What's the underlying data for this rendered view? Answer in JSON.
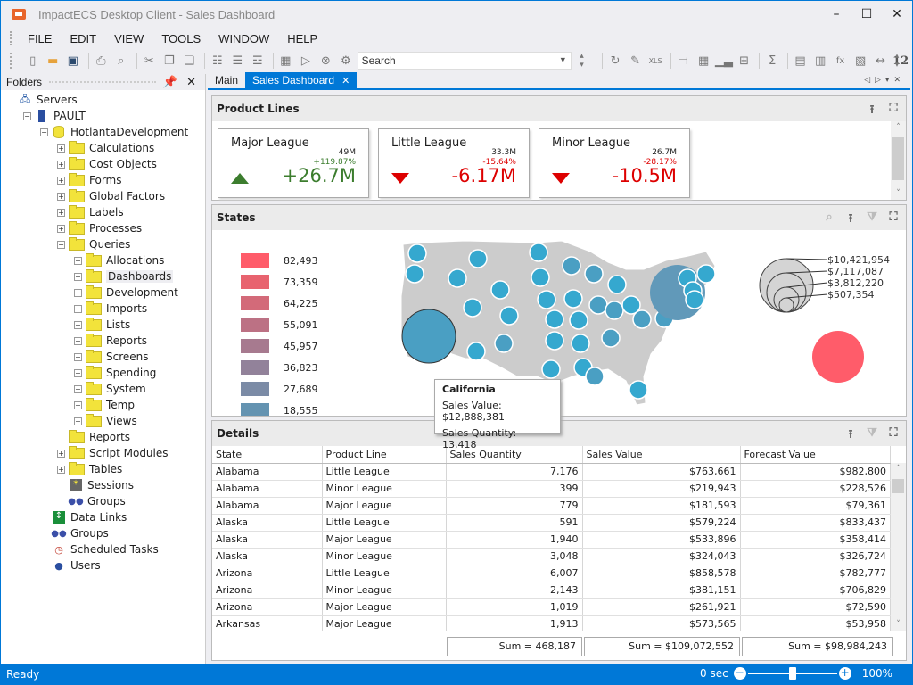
{
  "window": {
    "title": "ImpactECS Desktop Client - Sales Dashboard"
  },
  "menu": [
    "FILE",
    "EDIT",
    "VIEW",
    "TOOLS",
    "WINDOW",
    "HELP"
  ],
  "toolbar": {
    "search_placeholder": "Search",
    "search_value": "Search",
    "number_label": "12"
  },
  "sidebar": {
    "title": "Folders",
    "tree": [
      {
        "label": "Servers",
        "level": 0,
        "icon": "servers-icon"
      },
      {
        "label": "PAULT",
        "level": 1,
        "icon": "server-icon",
        "expander": "minus"
      },
      {
        "label": "HotlantaDevelopment",
        "level": 2,
        "icon": "database-icon",
        "expander": "minus"
      },
      {
        "label": "Calculations",
        "level": 3,
        "icon": "folder-icon",
        "expander": "plus"
      },
      {
        "label": "Cost Objects",
        "level": 3,
        "icon": "folder-icon",
        "expander": "plus"
      },
      {
        "label": "Forms",
        "level": 3,
        "icon": "folder-icon",
        "expander": "plus"
      },
      {
        "label": "Global Factors",
        "level": 3,
        "icon": "folder-icon",
        "expander": "plus"
      },
      {
        "label": "Labels",
        "level": 3,
        "icon": "folder-icon",
        "expander": "plus"
      },
      {
        "label": "Processes",
        "level": 3,
        "icon": "folder-icon",
        "expander": "plus"
      },
      {
        "label": "Queries",
        "level": 3,
        "icon": "folder-icon",
        "expander": "minus"
      },
      {
        "label": "Allocations",
        "level": 4,
        "icon": "folder-icon",
        "expander": "plus"
      },
      {
        "label": "Dashboards",
        "level": 4,
        "icon": "folder-icon",
        "expander": "plus",
        "selected": true
      },
      {
        "label": "Development",
        "level": 4,
        "icon": "folder-icon",
        "expander": "plus"
      },
      {
        "label": "Imports",
        "level": 4,
        "icon": "folder-icon",
        "expander": "plus"
      },
      {
        "label": "Lists",
        "level": 4,
        "icon": "folder-icon",
        "expander": "plus"
      },
      {
        "label": "Reports",
        "level": 4,
        "icon": "folder-icon",
        "expander": "plus"
      },
      {
        "label": "Screens",
        "level": 4,
        "icon": "folder-icon",
        "expander": "plus"
      },
      {
        "label": "Spending",
        "level": 4,
        "icon": "folder-icon",
        "expander": "plus"
      },
      {
        "label": "System",
        "level": 4,
        "icon": "folder-icon",
        "expander": "plus"
      },
      {
        "label": "Temp",
        "level": 4,
        "icon": "folder-icon",
        "expander": "plus"
      },
      {
        "label": "Views",
        "level": 4,
        "icon": "folder-icon",
        "expander": "plus"
      },
      {
        "label": "Reports",
        "level": 3,
        "icon": "folder-icon"
      },
      {
        "label": "Script Modules",
        "level": 3,
        "icon": "folder-icon",
        "expander": "plus"
      },
      {
        "label": "Tables",
        "level": 3,
        "icon": "folder-icon",
        "expander": "plus"
      },
      {
        "label": "Sessions",
        "level": 3,
        "icon": "sessions-icon"
      },
      {
        "label": "Groups",
        "level": 3,
        "icon": "groups-icon"
      },
      {
        "label": "Data Links",
        "level": 2,
        "icon": "data-links-icon"
      },
      {
        "label": "Groups",
        "level": 2,
        "icon": "groups-icon"
      },
      {
        "label": "Scheduled Tasks",
        "level": 2,
        "icon": "scheduled-tasks-icon"
      },
      {
        "label": "Users",
        "level": 2,
        "icon": "users-icon"
      }
    ]
  },
  "tabs": [
    {
      "label": "Main"
    },
    {
      "label": "Sales Dashboard",
      "active": true
    }
  ],
  "product_lines": {
    "title": "Product Lines",
    "cards": [
      {
        "title": "Major League",
        "reference": "49M",
        "percent": "+119.87%",
        "delta": "+26.7M",
        "trend": "up"
      },
      {
        "title": "Little League",
        "reference": "33.3M",
        "percent": "-15.64%",
        "delta": "-6.17M",
        "trend": "down"
      },
      {
        "title": "Minor League",
        "reference": "26.7M",
        "percent": "-28.17%",
        "delta": "-10.5M",
        "trend": "down"
      }
    ]
  },
  "states": {
    "title": "States",
    "color_legend": [
      {
        "value": "82,493",
        "color": "#ff5c6a"
      },
      {
        "value": "73,359",
        "color": "#e8636f"
      },
      {
        "value": "64,225",
        "color": "#d36a79"
      },
      {
        "value": "55,091",
        "color": "#bc7184"
      },
      {
        "value": "45,957",
        "color": "#a77a8f"
      },
      {
        "value": "36,823",
        "color": "#92829a"
      },
      {
        "value": "27,689",
        "color": "#7b8ba6"
      },
      {
        "value": "18,555",
        "color": "#6493b1"
      }
    ],
    "size_legend": [
      "$10,421,954",
      "$7,117,087",
      "$3,812,220",
      "$507,354"
    ],
    "tooltip": {
      "title": "California",
      "sales_value": "Sales Value: $12,888,381",
      "sales_quantity": "Sales Quantity: 13,418"
    }
  },
  "details": {
    "title": "Details",
    "columns": [
      "State",
      "Product Line",
      "Sales Quantity",
      "Sales Value",
      "Forecast Value"
    ],
    "rows": [
      [
        "Alabama",
        "Little League",
        "7,176",
        "$763,661",
        "$982,800"
      ],
      [
        "Alabama",
        "Minor League",
        "399",
        "$219,943",
        "$228,526"
      ],
      [
        "Alabama",
        "Major League",
        "779",
        "$181,593",
        "$79,361"
      ],
      [
        "Alaska",
        "Little League",
        "591",
        "$579,224",
        "$833,437"
      ],
      [
        "Alaska",
        "Major League",
        "1,940",
        "$533,896",
        "$358,414"
      ],
      [
        "Alaska",
        "Minor League",
        "3,048",
        "$324,043",
        "$326,724"
      ],
      [
        "Arizona",
        "Little League",
        "6,007",
        "$858,578",
        "$782,777"
      ],
      [
        "Arizona",
        "Minor League",
        "2,143",
        "$381,151",
        "$706,829"
      ],
      [
        "Arizona",
        "Major League",
        "1,019",
        "$261,921",
        "$72,590"
      ],
      [
        "Arkansas",
        "Major League",
        "1,913",
        "$573,565",
        "$53,958"
      ]
    ],
    "totals": {
      "quantity": "Sum = 468,187",
      "value": "Sum = $109,072,552",
      "forecast": "Sum = $98,984,243"
    }
  },
  "status": {
    "text": "Ready",
    "timer": "0 sec",
    "zoom": "100%",
    "zoom_level": 0.5
  },
  "colors": {
    "accent": "#0078d7",
    "up": "#3c7d2e",
    "down": "#dd0000",
    "bubble": "#35a8cf"
  }
}
